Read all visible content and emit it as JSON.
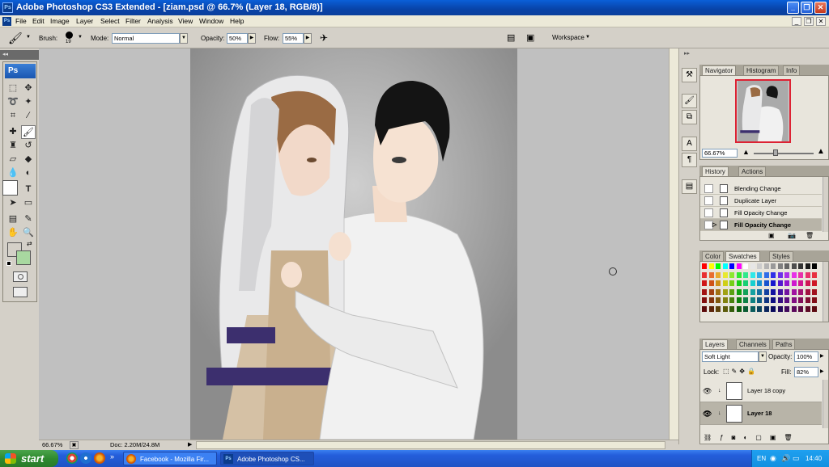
{
  "window": {
    "title": "Adobe Photoshop CS3 Extended - [ziam.psd @ 66.7% (Layer 18, RGB/8)]",
    "app_icon": "Ps"
  },
  "menu": [
    "File",
    "Edit",
    "Image",
    "Layer",
    "Select",
    "Filter",
    "Analysis",
    "View",
    "Window",
    "Help"
  ],
  "options": {
    "brush_label": "Brush:",
    "brush_size": "19",
    "mode_label": "Mode:",
    "mode_value": "Normal",
    "opacity_label": "Opacity:",
    "opacity_value": "50%",
    "flow_label": "Flow:",
    "flow_value": "55%",
    "workspace_label": "Workspace"
  },
  "toolbox": {
    "badge": "Ps"
  },
  "status": {
    "zoom": "66.67%",
    "doc": "Doc: 2.20M/24.8M"
  },
  "navigator": {
    "tabs": [
      "Navigator",
      "Histogram",
      "Info"
    ],
    "zoom": "66.67%"
  },
  "history": {
    "tabs": [
      "History",
      "Actions"
    ],
    "items": [
      "Blending Change",
      "Duplicate Layer",
      "Fill Opacity Change",
      "Fill Opacity Change"
    ],
    "active_index": 3
  },
  "swatches": {
    "tabs": [
      "Color",
      "Swatches",
      "Styles"
    ]
  },
  "layers": {
    "tabs": [
      "Layers",
      "Channels",
      "Paths"
    ],
    "blend_mode": "Soft Light",
    "opacity_label": "Opacity:",
    "opacity_value": "100%",
    "lock_label": "Lock:",
    "fill_label": "Fill:",
    "fill_value": "82%",
    "items": [
      {
        "name": "Layer 18 copy",
        "selected": false
      },
      {
        "name": "Layer 18",
        "selected": true
      }
    ]
  },
  "taskbar": {
    "start_label": "start",
    "items": [
      "Facebook - Mozilla Fir...",
      "Adobe Photoshop CS..."
    ],
    "tray_lang": "EN",
    "clock": "14:40"
  },
  "colors": {
    "foreground": "#ffffff",
    "background": "#a8d8a0",
    "accent": "#0a5fd8"
  }
}
